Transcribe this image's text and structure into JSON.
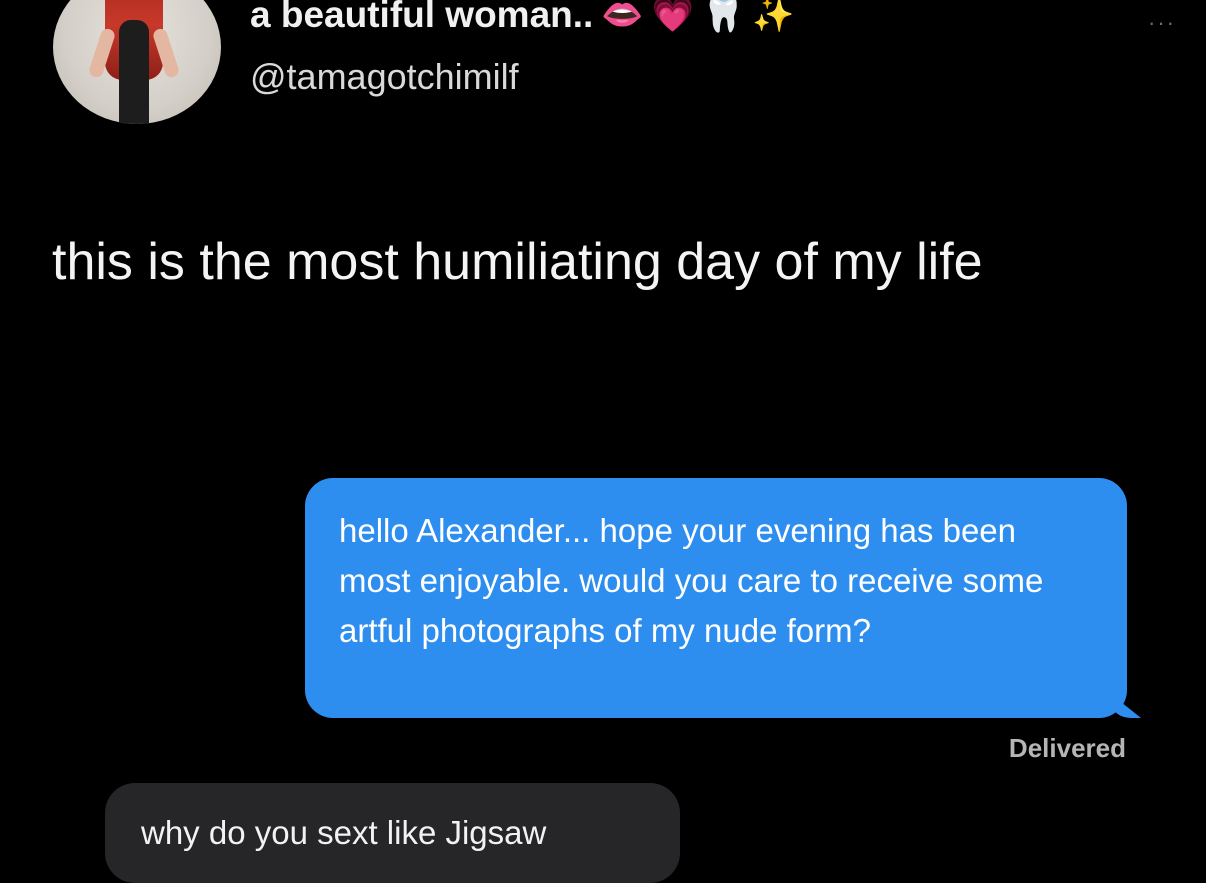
{
  "tweet": {
    "display_name": "a beautiful woman..",
    "name_emojis": {
      "lips": "👄",
      "heart": "💗",
      "tooth": "🦷",
      "sparkles": "✨"
    },
    "handle": "@tamagotchimilf",
    "more_icon": "···",
    "text": "this is the most humiliating day of my life"
  },
  "messages": {
    "outgoing": "hello Alexander... hope your evening has been most enjoyable. would you care to receive some artful photographs of my nude form?",
    "status": "Delivered",
    "incoming": "why do you sext like Jigsaw"
  },
  "colors": {
    "background": "#000000",
    "outgoing_bubble": "#2d8ef0",
    "incoming_bubble": "#262628"
  }
}
